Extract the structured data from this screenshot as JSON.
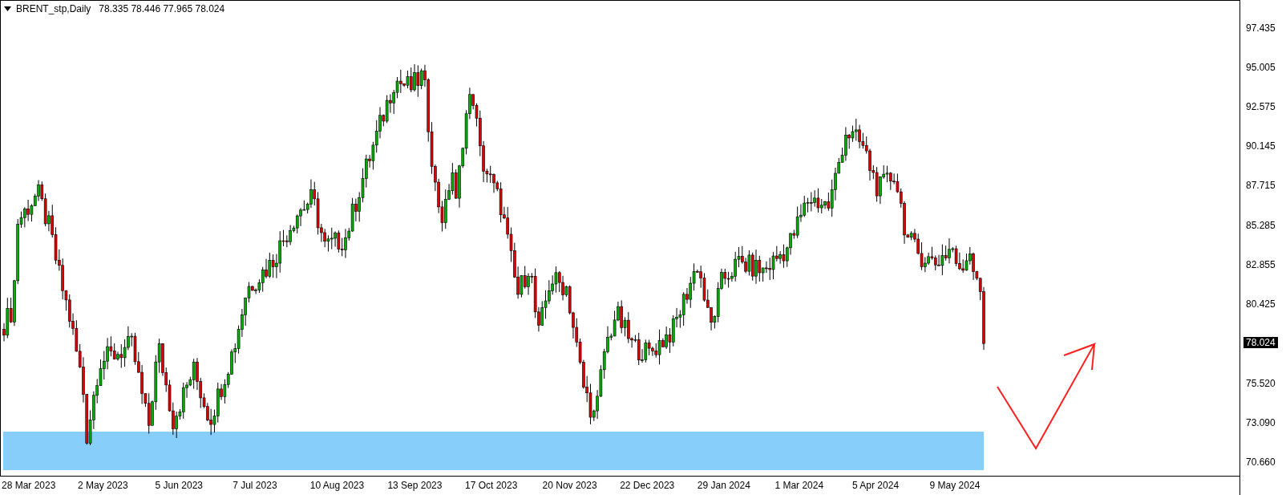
{
  "chart": {
    "symbol": "BRENT_stp,Daily",
    "quote": "78.335 78.446 77.965 78.024"
  },
  "price_axis": {
    "ticks": [
      "97.435",
      "95.005",
      "92.575",
      "90.145",
      "87.715",
      "85.285",
      "82.855",
      "80.425",
      "75.520",
      "73.090",
      "70.660"
    ],
    "current_price": "78.024"
  },
  "time_axis": {
    "labels": [
      "28 Mar 2023",
      "2 May 2023",
      "5 Jun 2023",
      "7 Jul 2023",
      "10 Aug 2023",
      "13 Sep 2023",
      "17 Oct 2023",
      "20 Nov 2023",
      "22 Dec 2023",
      "29 Jan 2024",
      "1 Mar 2024",
      "5 Apr 2024",
      "9 May 2024"
    ]
  }
}
